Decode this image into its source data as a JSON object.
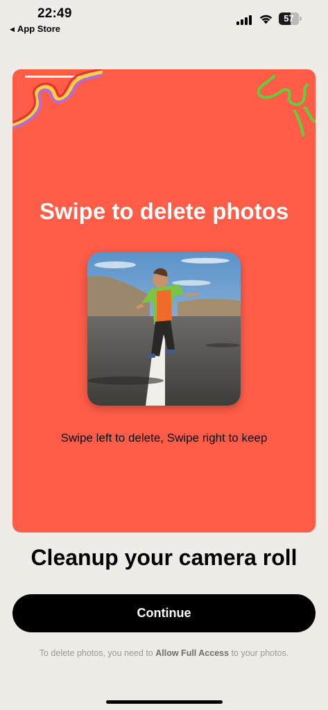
{
  "status_bar": {
    "time": "22:49",
    "back_label": "App Store",
    "battery_percent": "57",
    "battery_level": 0.57
  },
  "card": {
    "background_color": "#ff5d48",
    "title": "Swipe to delete photos",
    "hint": "Swipe left to delete, Swipe right to keep",
    "photo_icon": "child-jumping-on-road-photo"
  },
  "headline": "Cleanup your camera roll",
  "continue_label": "Continue",
  "footnote": {
    "prefix": "To delete photos, you need to ",
    "emphasis": "Allow Full Access",
    "suffix": " to your photos."
  }
}
